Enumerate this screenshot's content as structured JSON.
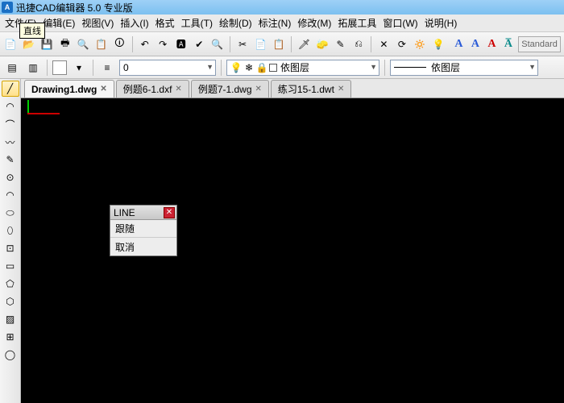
{
  "app": {
    "title": "迅捷CAD编辑器 5.0 专业版"
  },
  "menu": [
    "文件(F)",
    "编辑(E)",
    "视图(V)",
    "插入(I)",
    "格式",
    "工具(T)",
    "绘制(D)",
    "标注(N)",
    "修改(M)",
    "拓展工具",
    "窗口(W)",
    "说明(H)"
  ],
  "row2": {
    "swatch_color": "#ffffff",
    "lineweight_box": "0",
    "layer_combo": "依图层",
    "linetype_combo": "依图层",
    "standard": "Standard"
  },
  "tabs": [
    {
      "label": "Drawing1.dwg",
      "active": true
    },
    {
      "label": "例题6-1.dxf",
      "active": false
    },
    {
      "label": "例题7-1.dwg",
      "active": false
    },
    {
      "label": "练习15-1.dwt",
      "active": false
    }
  ],
  "tooltip": "直线",
  "popup": {
    "title": "LINE",
    "items": [
      "跟随",
      "取消"
    ]
  },
  "icons": {
    "toolbar": [
      "📄",
      "📂",
      "💾",
      "🖶",
      "🔍",
      "📋",
      "🛈",
      "↶",
      "↷",
      "🅰",
      "✔",
      "🔍",
      "✂",
      "📄",
      "📋",
      "🗡",
      "🧽",
      "✎",
      "⎌",
      "✕",
      "⟳",
      "🔅",
      "💡"
    ],
    "vtool": [
      "╱",
      "◠",
      "⌒",
      "〰",
      "✎",
      "⊙",
      "◠",
      "⬭",
      "⬯",
      "⊡",
      "▭",
      "⬠",
      "⬡",
      "▨",
      "⊞",
      "◯"
    ]
  }
}
